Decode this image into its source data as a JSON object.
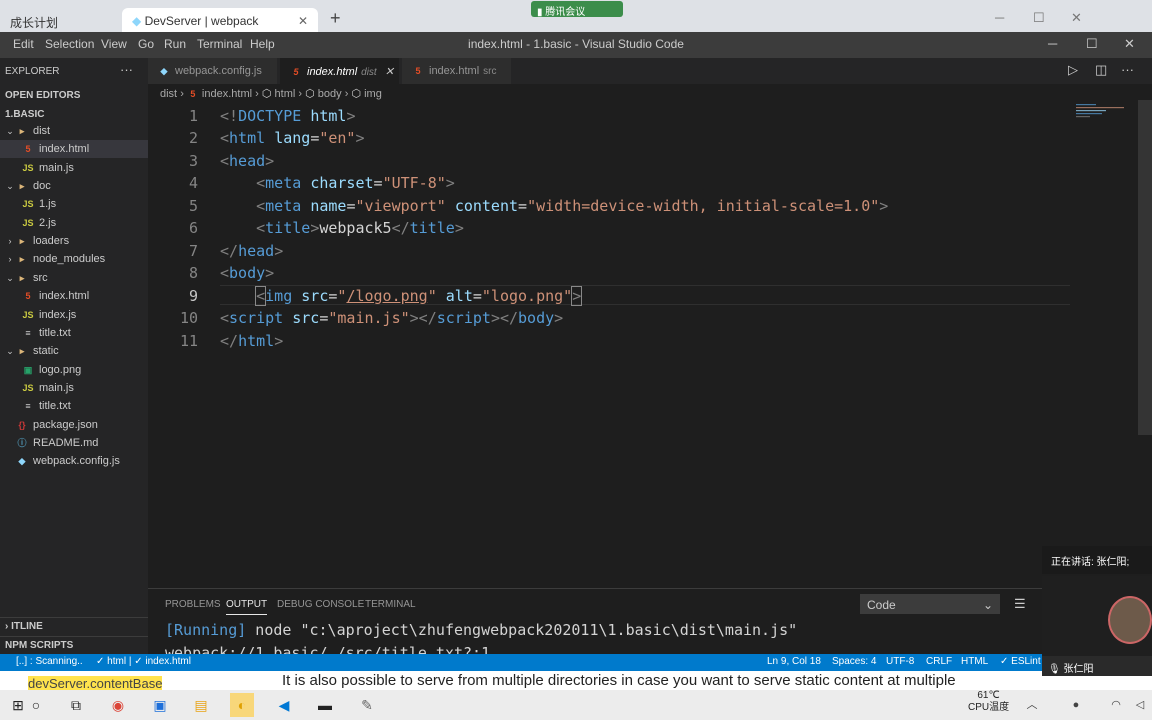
{
  "browser": {
    "tab1": "成长计划",
    "tab2": "DevServer | webpack",
    "meeting_badge": "腾讯会议"
  },
  "menu": [
    "Edit",
    "Selection",
    "View",
    "Go",
    "Run",
    "Terminal",
    "Help"
  ],
  "window_title": "index.html - 1.basic - Visual Studio Code",
  "sidebar": {
    "explorer_label": "EXPLORER",
    "open_editors": "OPEN EDITORS",
    "project": "1.BASIC",
    "tree": [
      {
        "label": "dist",
        "type": "folder",
        "depth": 0,
        "open": true
      },
      {
        "label": "index.html",
        "type": "html",
        "depth": 1,
        "selected": true
      },
      {
        "label": "main.js",
        "type": "js",
        "depth": 1
      },
      {
        "label": "doc",
        "type": "folder",
        "depth": 0,
        "open": true
      },
      {
        "label": "1.js",
        "type": "js",
        "depth": 1
      },
      {
        "label": "2.js",
        "type": "js",
        "depth": 1
      },
      {
        "label": "loaders",
        "type": "folder",
        "depth": 0,
        "open": false
      },
      {
        "label": "node_modules",
        "type": "folder",
        "depth": 0,
        "open": false
      },
      {
        "label": "src",
        "type": "folder",
        "depth": 0,
        "open": true
      },
      {
        "label": "index.html",
        "type": "html",
        "depth": 1
      },
      {
        "label": "index.js",
        "type": "js",
        "depth": 1
      },
      {
        "label": "title.txt",
        "type": "txt",
        "depth": 1
      },
      {
        "label": "static",
        "type": "folder",
        "depth": 0,
        "open": true
      },
      {
        "label": "logo.png",
        "type": "png",
        "depth": 1
      },
      {
        "label": "main.js",
        "type": "js",
        "depth": 1
      },
      {
        "label": "title.txt",
        "type": "txt",
        "depth": 1
      },
      {
        "label": "package.json",
        "type": "json",
        "depth": 0
      },
      {
        "label": "README.md",
        "type": "md",
        "depth": 0
      },
      {
        "label": "webpack.config.js",
        "type": "wp",
        "depth": 0
      }
    ],
    "outline": "ITLINE",
    "npm_scripts": "NPM SCRIPTS"
  },
  "tabs": [
    {
      "label": "webpack.config.js",
      "dir": ""
    },
    {
      "label": "index.html",
      "dir": "dist",
      "active": true
    },
    {
      "label": "index.html",
      "dir": "src"
    }
  ],
  "breadcrumb": [
    "dist",
    "index.html",
    "html",
    "body",
    "img"
  ],
  "code_lines": [
    "1",
    "2",
    "3",
    "4",
    "5",
    "6",
    "7",
    "8",
    "9",
    "10",
    "11"
  ],
  "panel": {
    "tabs": [
      "PROBLEMS",
      "OUTPUT",
      "DEBUG CONSOLE",
      "TERMINAL"
    ],
    "active": "OUTPUT",
    "select": "Code",
    "line1_running": "[Running]",
    "line1_cmd": " node \"c:\\aproject\\zhufengwebpack202011\\1.basic\\dist\\main.js\"",
    "line2": "webpack://1.basic/./src/title.txt?:1"
  },
  "status": {
    "scanning": "[..] : Scanning..",
    "html_check": "✓ html | ✓ index.html",
    "position": "Ln 9, Col 18",
    "spaces": "Spaces: 4",
    "encoding": "UTF-8",
    "eol": "CRLF",
    "lang": "HTML",
    "eslint": "✓ ESLint"
  },
  "subtitle": "It is also possible to serve from multiple directories in case you want to serve static content at multiple",
  "behind_text": "devServer.contentBase",
  "meeting": {
    "speaking": "正在讲话: 张仁阳;",
    "speaker": "张仁阳"
  },
  "taskbar": {
    "temp": "61℃",
    "cpu": "CPU温度"
  }
}
